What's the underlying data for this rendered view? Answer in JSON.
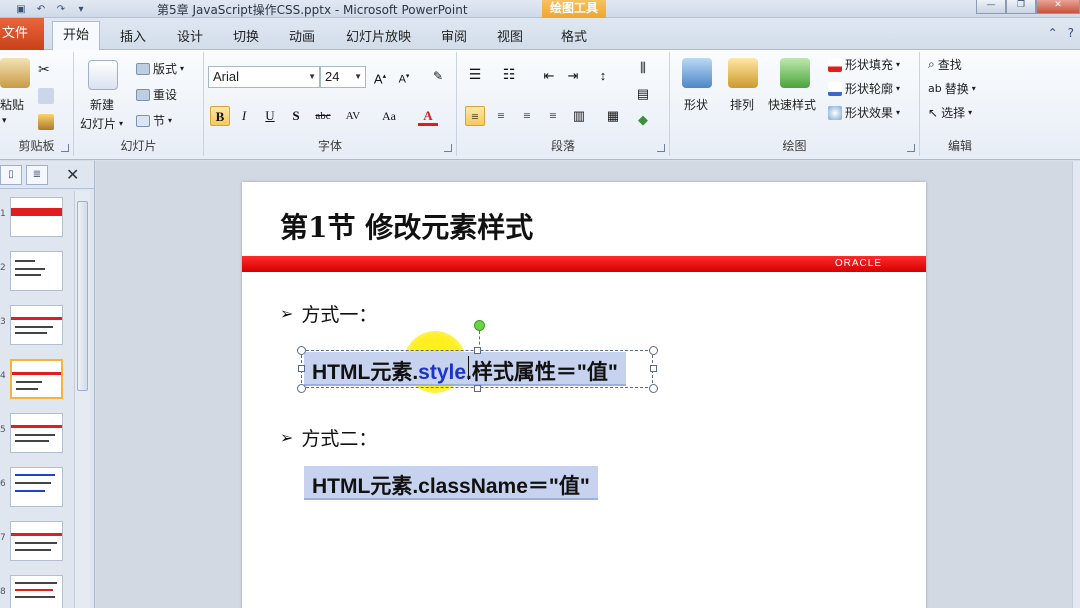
{
  "window": {
    "title": "第5章  JavaScript操作CSS.pptx  -  Microsoft PowerPoint",
    "contextual_tab": "绘图工具"
  },
  "tabs": {
    "file": "文件",
    "home": "开始",
    "insert": "插入",
    "design": "设计",
    "transitions": "切换",
    "animations": "动画",
    "slideshow": "幻灯片放映",
    "review": "审阅",
    "view": "视图",
    "format": "格式"
  },
  "ribbon": {
    "clipboard": {
      "paste": "粘贴",
      "label": "剪贴板"
    },
    "slides": {
      "new_slide": "新建",
      "new_slide2": "幻灯片",
      "layout": "版式",
      "reset": "重设",
      "section": "节",
      "label": "幻灯片"
    },
    "font": {
      "family": "Arial",
      "size": "24",
      "bold": "B",
      "italic": "I",
      "underline": "U",
      "shadow": "S",
      "strike": "abc",
      "spacing": "AV",
      "case": "Aa",
      "color": "A",
      "label": "字体"
    },
    "paragraph": {
      "label": "段落"
    },
    "drawing": {
      "shapes": "形状",
      "arrange": "排列",
      "quick_styles": "快速样式",
      "fill": "形状填充",
      "outline": "形状轮廓",
      "effects": "形状效果",
      "label": "绘图"
    },
    "editing": {
      "find": "查找",
      "replace": "替换",
      "select": "选择",
      "label": "编辑"
    }
  },
  "slide": {
    "title": "第1节  修改元素样式",
    "brand": "ORACLE",
    "bullet1": "方式一：",
    "code1_a": "HTML元素.",
    "code1_b": "style",
    "code1_c": ".样式属性＝\"值\"",
    "bullet2": "方式二：",
    "code2": "HTML元素.className＝\"值\""
  },
  "thumbnails": [
    "1",
    "2",
    "3",
    "4",
    "5",
    "6",
    "7",
    "8"
  ],
  "colors": {
    "accent_red": "#e21d1d",
    "code_bg": "#c7d2ee",
    "highlight_blue": "#1b33c6"
  }
}
